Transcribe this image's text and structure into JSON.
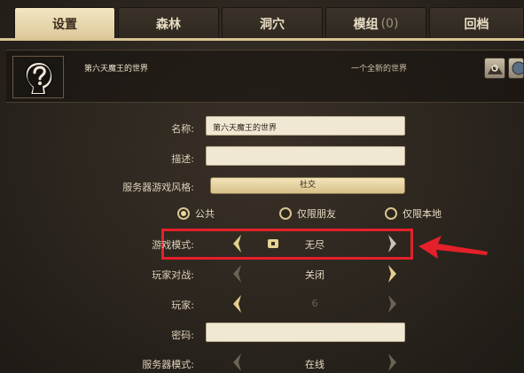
{
  "tabs": [
    {
      "label": "设置",
      "active": true
    },
    {
      "label": "森林",
      "active": false
    },
    {
      "label": "洞穴",
      "active": false
    },
    {
      "label": "模组",
      "count": "(0)",
      "active": false
    },
    {
      "label": "回档",
      "active": false
    }
  ],
  "header": {
    "world_name": "第六天魔王的世界",
    "world_subtitle": "一个全新的世界",
    "icon": "question-mark-head-icon"
  },
  "form": {
    "name_label": "名称:",
    "name_value": "第六天魔王的世界",
    "desc_label": "描述:",
    "desc_value": "",
    "style_label": "服务器游戏风格:",
    "style_value": "社交",
    "privacy": [
      {
        "label": "公共",
        "selected": true
      },
      {
        "label": "仅限朋友",
        "selected": false
      },
      {
        "label": "仅限本地",
        "selected": false
      }
    ],
    "mode_label": "游戏模式:",
    "mode_value": "无尽",
    "pvp_label": "玩家对战:",
    "pvp_value": "关闭",
    "players_label": "玩家:",
    "players_value": "6",
    "password_label": "密码:",
    "password_value": "",
    "server_mode_label": "服务器模式:",
    "server_mode_value": "在线"
  },
  "colors": {
    "highlight": "#e5202a",
    "gold": "#e2cd8f",
    "active_tab": "#f3e6c2"
  }
}
